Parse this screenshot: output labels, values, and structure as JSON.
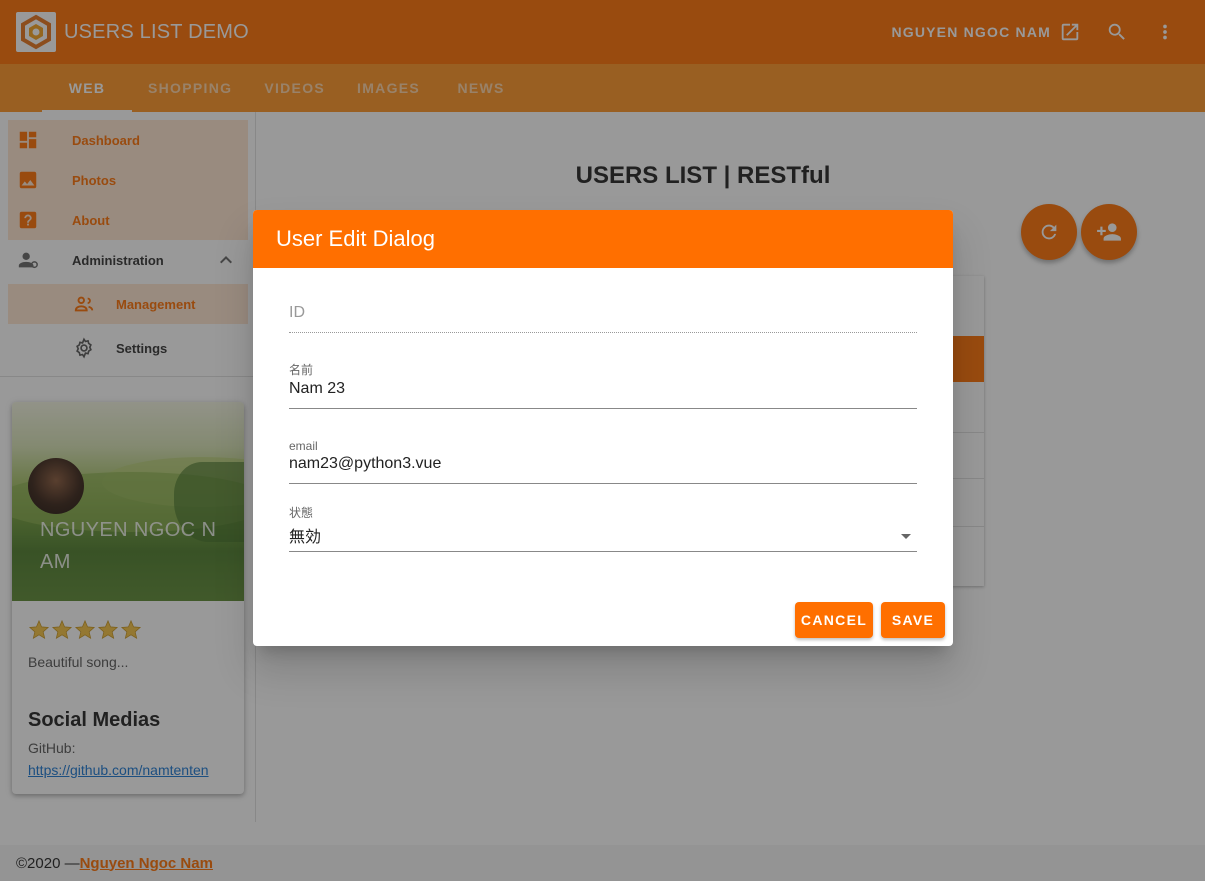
{
  "app": {
    "title": "USERS LIST DEMO",
    "user_name": "NGUYEN NGOC NAM"
  },
  "icons": {
    "logo": "hexagon-logo-icon",
    "open_in_new": "open-in-new-icon",
    "search": "search-icon",
    "more": "more-vertical-icon"
  },
  "tabs": [
    {
      "label": "WEB",
      "active": true
    },
    {
      "label": "SHOPPING",
      "active": false
    },
    {
      "label": "VIDEOS",
      "active": false
    },
    {
      "label": "IMAGES",
      "active": false
    },
    {
      "label": "NEWS",
      "active": false
    }
  ],
  "sidebar": {
    "items": [
      {
        "label": "Dashboard",
        "icon": "dashboard-icon"
      },
      {
        "label": "Photos",
        "icon": "image-icon"
      },
      {
        "label": "About",
        "icon": "help-box-icon"
      },
      {
        "label": "Administration",
        "icon": "account-cog-icon",
        "expanded": true
      },
      {
        "label": "Management",
        "icon": "account-group-icon"
      },
      {
        "label": "Settings",
        "icon": "settings-icon"
      }
    ]
  },
  "profile": {
    "name": "NGUYEN NGOC NAM",
    "rating": 5,
    "subtitle": "Beautiful song...",
    "heading": "Social Medias",
    "github_label": "GitHub:",
    "github_link": "https://github.com/namtenten"
  },
  "main": {
    "title": "USERS LIST | RESTful"
  },
  "dialog": {
    "title": "User Edit Dialog",
    "id_label": "ID",
    "name_label": "名前",
    "name_value": "Nam 23",
    "email_label": "email",
    "email_value": "nam23@python3.vue",
    "status_label": "状態",
    "status_value": "無効",
    "cancel_label": "CANCEL",
    "save_label": "SAVE"
  },
  "footer": {
    "copyright": "©2020 —",
    "author": "Nguyen Ngoc Nam"
  },
  "colors": {
    "primary": "#ff6f00",
    "primary_light": "#ff9524",
    "link": "#1976d2"
  }
}
